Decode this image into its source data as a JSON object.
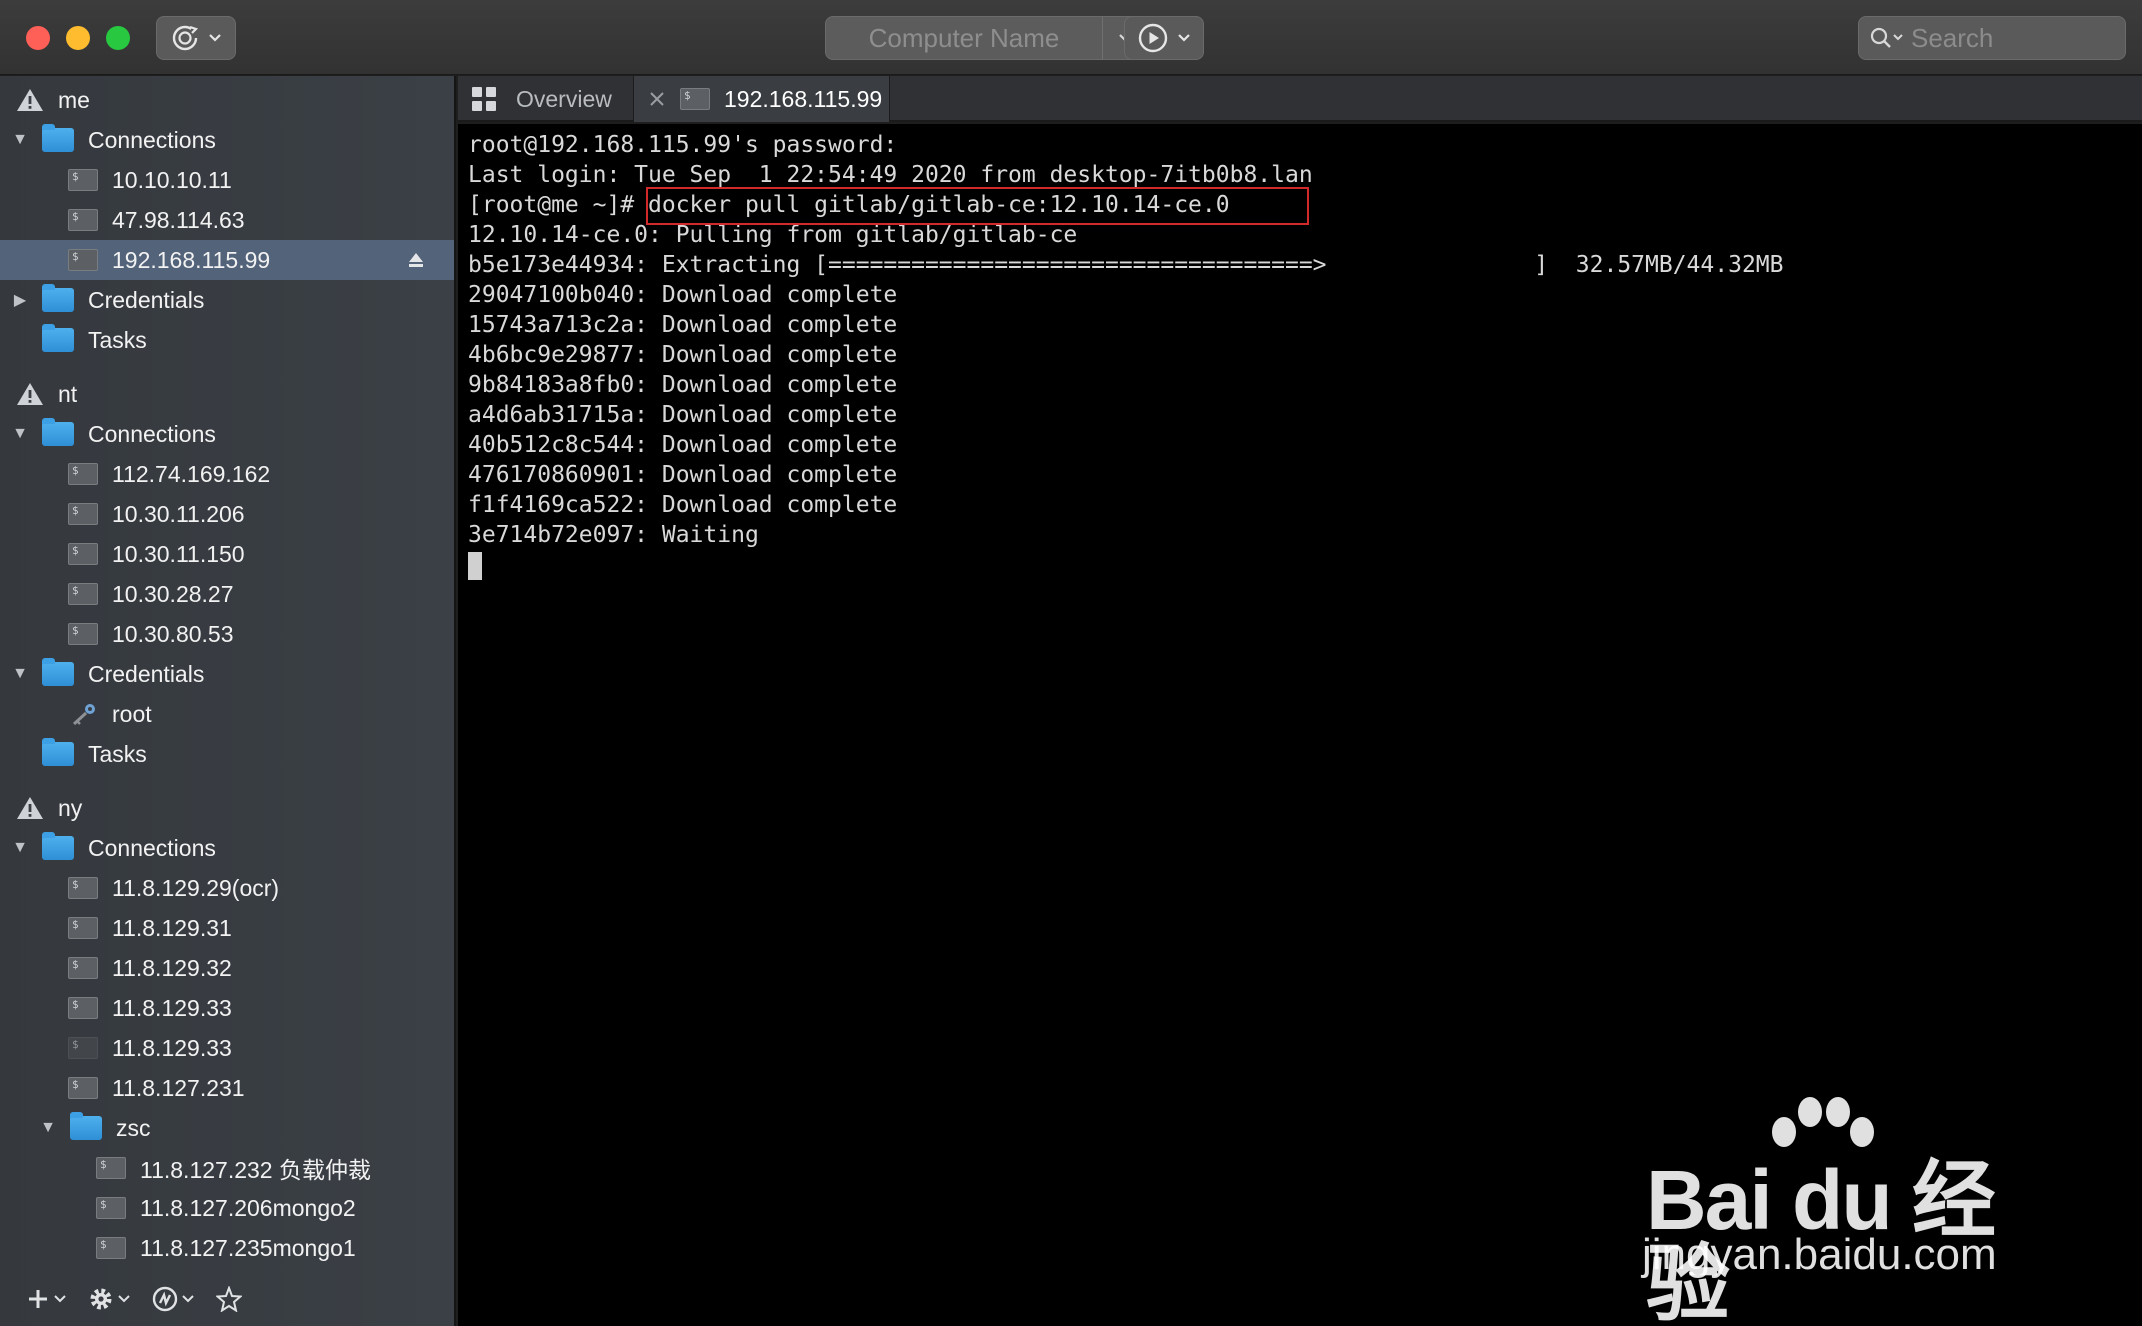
{
  "window": {
    "traffic_lights": [
      "close",
      "minimize",
      "maximize"
    ],
    "colors": {
      "close": "#fe5f57",
      "minimize": "#febc2e",
      "maximize": "#28c840"
    }
  },
  "toolbar": {
    "sync_icon": "sync-icon",
    "computer_name_placeholder": "Computer Name",
    "play_icon": "play-circle-icon",
    "search_placeholder": "Search"
  },
  "sidebar": {
    "groups": [
      {
        "name": "me",
        "connections_label": "Connections",
        "connections": [
          "10.10.10.11",
          "47.98.114.63",
          "192.168.115.99"
        ],
        "selected_connection": "192.168.115.99",
        "credentials_label": "Credentials",
        "tasks_label": "Tasks"
      },
      {
        "name": "nt",
        "connections_label": "Connections",
        "connections": [
          "112.74.169.162",
          "10.30.11.206",
          "10.30.11.150",
          "10.30.28.27",
          "10.30.80.53"
        ],
        "credentials_label": "Credentials",
        "credentials": [
          "root"
        ],
        "tasks_label": "Tasks"
      },
      {
        "name": "ny",
        "connections_label": "Connections",
        "connections": [
          "11.8.129.29(ocr)",
          "11.8.129.31",
          "11.8.129.32",
          "11.8.129.33",
          "11.8.129.33",
          "11.8.127.231"
        ],
        "subfolder": {
          "name": "zsc",
          "connections": [
            "11.8.127.232 负载仲裁",
            "11.8.127.206mongo2",
            "11.8.127.235mongo1"
          ]
        }
      }
    ],
    "bottom_icons": [
      "add-icon",
      "gear-icon",
      "network-icon",
      "star-icon"
    ],
    "selection_color": "#52637a"
  },
  "tabs": [
    {
      "label": "Overview",
      "icon": "grid-icon",
      "active": false
    },
    {
      "label": "192.168.115.99",
      "icon": "terminal-icon",
      "active": true
    }
  ],
  "terminal": {
    "lines": [
      "root@192.168.115.99's password:",
      "Last login: Tue Sep  1 22:54:49 2020 from desktop-7itb0b8.lan",
      "[root@me ~]# docker pull gitlab/gitlab-ce:12.10.14-ce.0",
      "12.10.14-ce.0: Pulling from gitlab/gitlab-ce",
      "b5e173e44934: Extracting [===================================>               ]  32.57MB/44.32MB",
      "29047100b040: Download complete",
      "15743a713c2a: Download complete",
      "4b6bc9e29877: Download complete",
      "9b84183a8fb0: Download complete",
      "a4d6ab31715a: Download complete",
      "40b512c8c544: Download complete",
      "476170860901: Download complete",
      "f1f4169ca522: Download complete",
      "3e714b72e097: Waiting"
    ],
    "highlight_color": "#d22a2a"
  },
  "watermark": {
    "logo_text": "Bai du 经验",
    "url": "jingyan.baidu.com"
  }
}
